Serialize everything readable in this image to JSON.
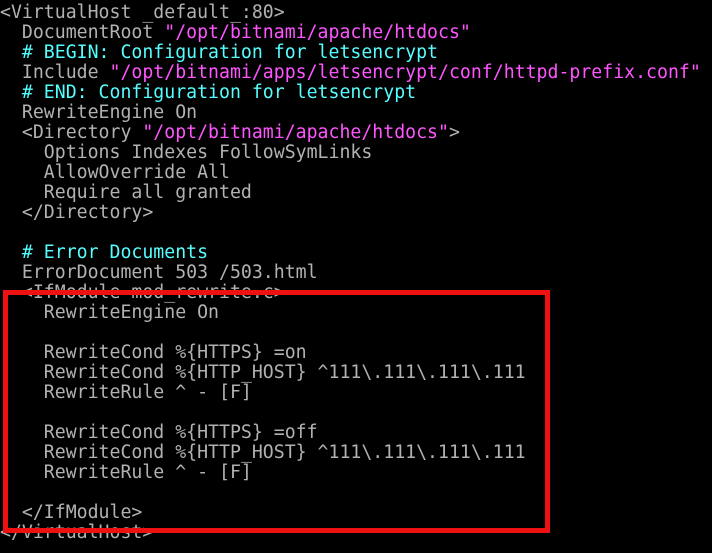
{
  "colors": {
    "background": "#000000",
    "default_text": "#b2b2b2",
    "string": "#ff55ff",
    "comment": "#55ffff",
    "highlight_box": "#ee1111"
  },
  "lines": [
    [
      {
        "t": "<VirtualHost _default_:80>",
        "c": "default_text"
      }
    ],
    [
      {
        "t": "  DocumentRoot ",
        "c": "default_text"
      },
      {
        "t": "\"/opt/bitnami/apache/htdocs\"",
        "c": "string"
      }
    ],
    [
      {
        "t": "  # BEGIN: Configuration for letsencrypt",
        "c": "comment"
      }
    ],
    [
      {
        "t": "  Include ",
        "c": "default_text"
      },
      {
        "t": "\"/opt/bitnami/apps/letsencrypt/conf/httpd-prefix.conf\"",
        "c": "string"
      }
    ],
    [
      {
        "t": "  # END: Configuration for letsencrypt",
        "c": "comment"
      }
    ],
    [
      {
        "t": "  RewriteEngine On",
        "c": "default_text"
      }
    ],
    [
      {
        "t": "  <Directory ",
        "c": "default_text"
      },
      {
        "t": "\"/opt/bitnami/apache/htdocs\"",
        "c": "string"
      },
      {
        "t": ">",
        "c": "default_text"
      }
    ],
    [
      {
        "t": "    Options Indexes FollowSymLinks",
        "c": "default_text"
      }
    ],
    [
      {
        "t": "    AllowOverride All",
        "c": "default_text"
      }
    ],
    [
      {
        "t": "    Require all granted",
        "c": "default_text"
      }
    ],
    [
      {
        "t": "  </Directory>",
        "c": "default_text"
      }
    ],
    [],
    [
      {
        "t": "  # Error Documents",
        "c": "comment"
      }
    ],
    [
      {
        "t": "  ErrorDocument 503 /503.html",
        "c": "default_text"
      }
    ],
    [
      {
        "t": "  <IfModule mod_rewrite.c>",
        "c": "default_text"
      }
    ],
    [
      {
        "t": "    RewriteEngine On",
        "c": "default_text"
      }
    ],
    [],
    [
      {
        "t": "    RewriteCond %{HTTPS} =on",
        "c": "default_text"
      }
    ],
    [
      {
        "t": "    RewriteCond %{HTTP_HOST} ^111\\.111\\.111\\.111",
        "c": "default_text"
      }
    ],
    [
      {
        "t": "    RewriteRule ^ - [F]",
        "c": "default_text"
      }
    ],
    [],
    [
      {
        "t": "    RewriteCond %{HTTPS} =off",
        "c": "default_text"
      }
    ],
    [
      {
        "t": "    RewriteCond %{HTTP_HOST} ^111\\.111\\.111\\.111",
        "c": "default_text"
      }
    ],
    [
      {
        "t": "    RewriteRule ^ - [F]",
        "c": "default_text"
      }
    ],
    [],
    [
      {
        "t": "  </IfModule>",
        "c": "default_text"
      }
    ],
    [
      {
        "t": "</VirtualHost>",
        "c": "default_text"
      }
    ]
  ]
}
